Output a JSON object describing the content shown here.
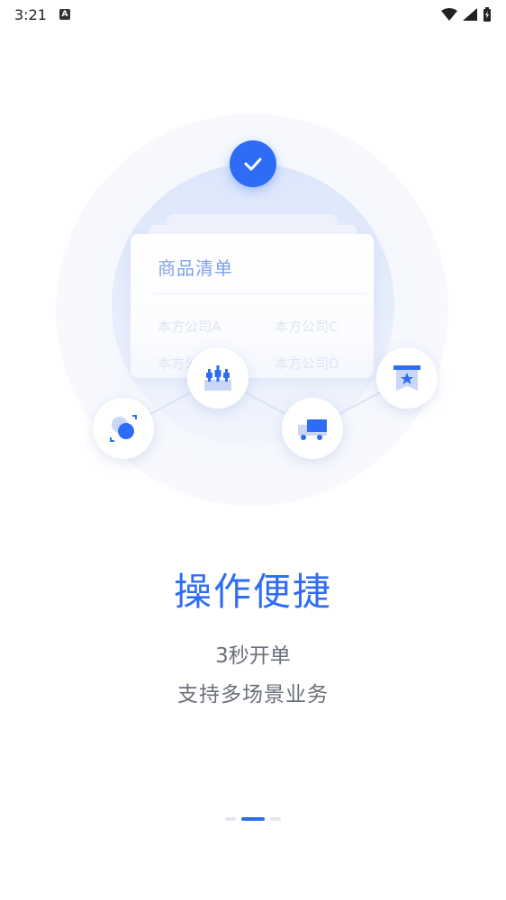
{
  "status_bar": {
    "time": "3:21",
    "notification_icon": "A"
  },
  "illustration": {
    "card_title": "商品清单",
    "rows": [
      [
        "本方公司A",
        "本方公司C"
      ],
      [
        "本方公",
        "本方公司D"
      ]
    ],
    "accent_color": "#2f6cf6"
  },
  "content": {
    "headline": "操作便捷",
    "subtitle_line1": "3秒开单",
    "subtitle_line2": "支持多场景业务"
  },
  "pager": {
    "count": 3,
    "active_index": 1
  }
}
